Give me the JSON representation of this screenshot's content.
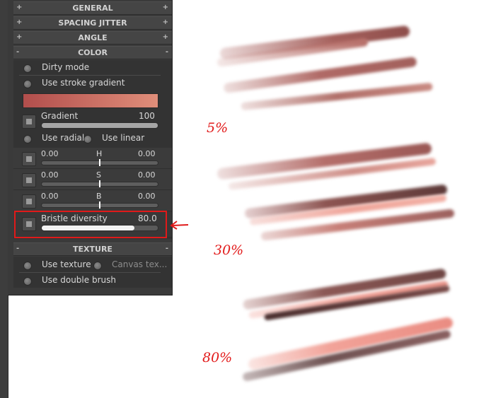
{
  "sections": {
    "general": "GENERAL",
    "spacing_jitter": "SPACING JITTER",
    "angle": "ANGLE",
    "color": "COLOR",
    "texture": "TEXTURE"
  },
  "toggles": {
    "plus": "+",
    "minus": "-"
  },
  "color": {
    "dirty_mode": "Dirty mode",
    "use_stroke_gradient": "Use stroke gradient",
    "gradient_start": "#b24e4c",
    "gradient_end": "#e08e7a",
    "gradient_label": "Gradient",
    "gradient_value": "100",
    "gradient_fraction": 1.0,
    "use_radial": "Use radial",
    "use_linear": "Use linear",
    "h_value": "0.00",
    "h_label": "H",
    "h_right": "0.00",
    "s_value": "0.00",
    "s_label": "S",
    "s_right": "0.00",
    "b_value": "0.00",
    "b_label": "B",
    "b_right": "0.00",
    "bristle_label": "Bristle diversity",
    "bristle_value": "80.0",
    "bristle_fraction": 0.8
  },
  "texture": {
    "use_texture": "Use texture",
    "canvas_texture": "Canvas tex...",
    "use_double_brush": "Use double brush"
  },
  "annotations": {
    "label_5": "5%",
    "label_30": "30%",
    "label_80": "80%",
    "highlight_color": "#e01a1a"
  }
}
